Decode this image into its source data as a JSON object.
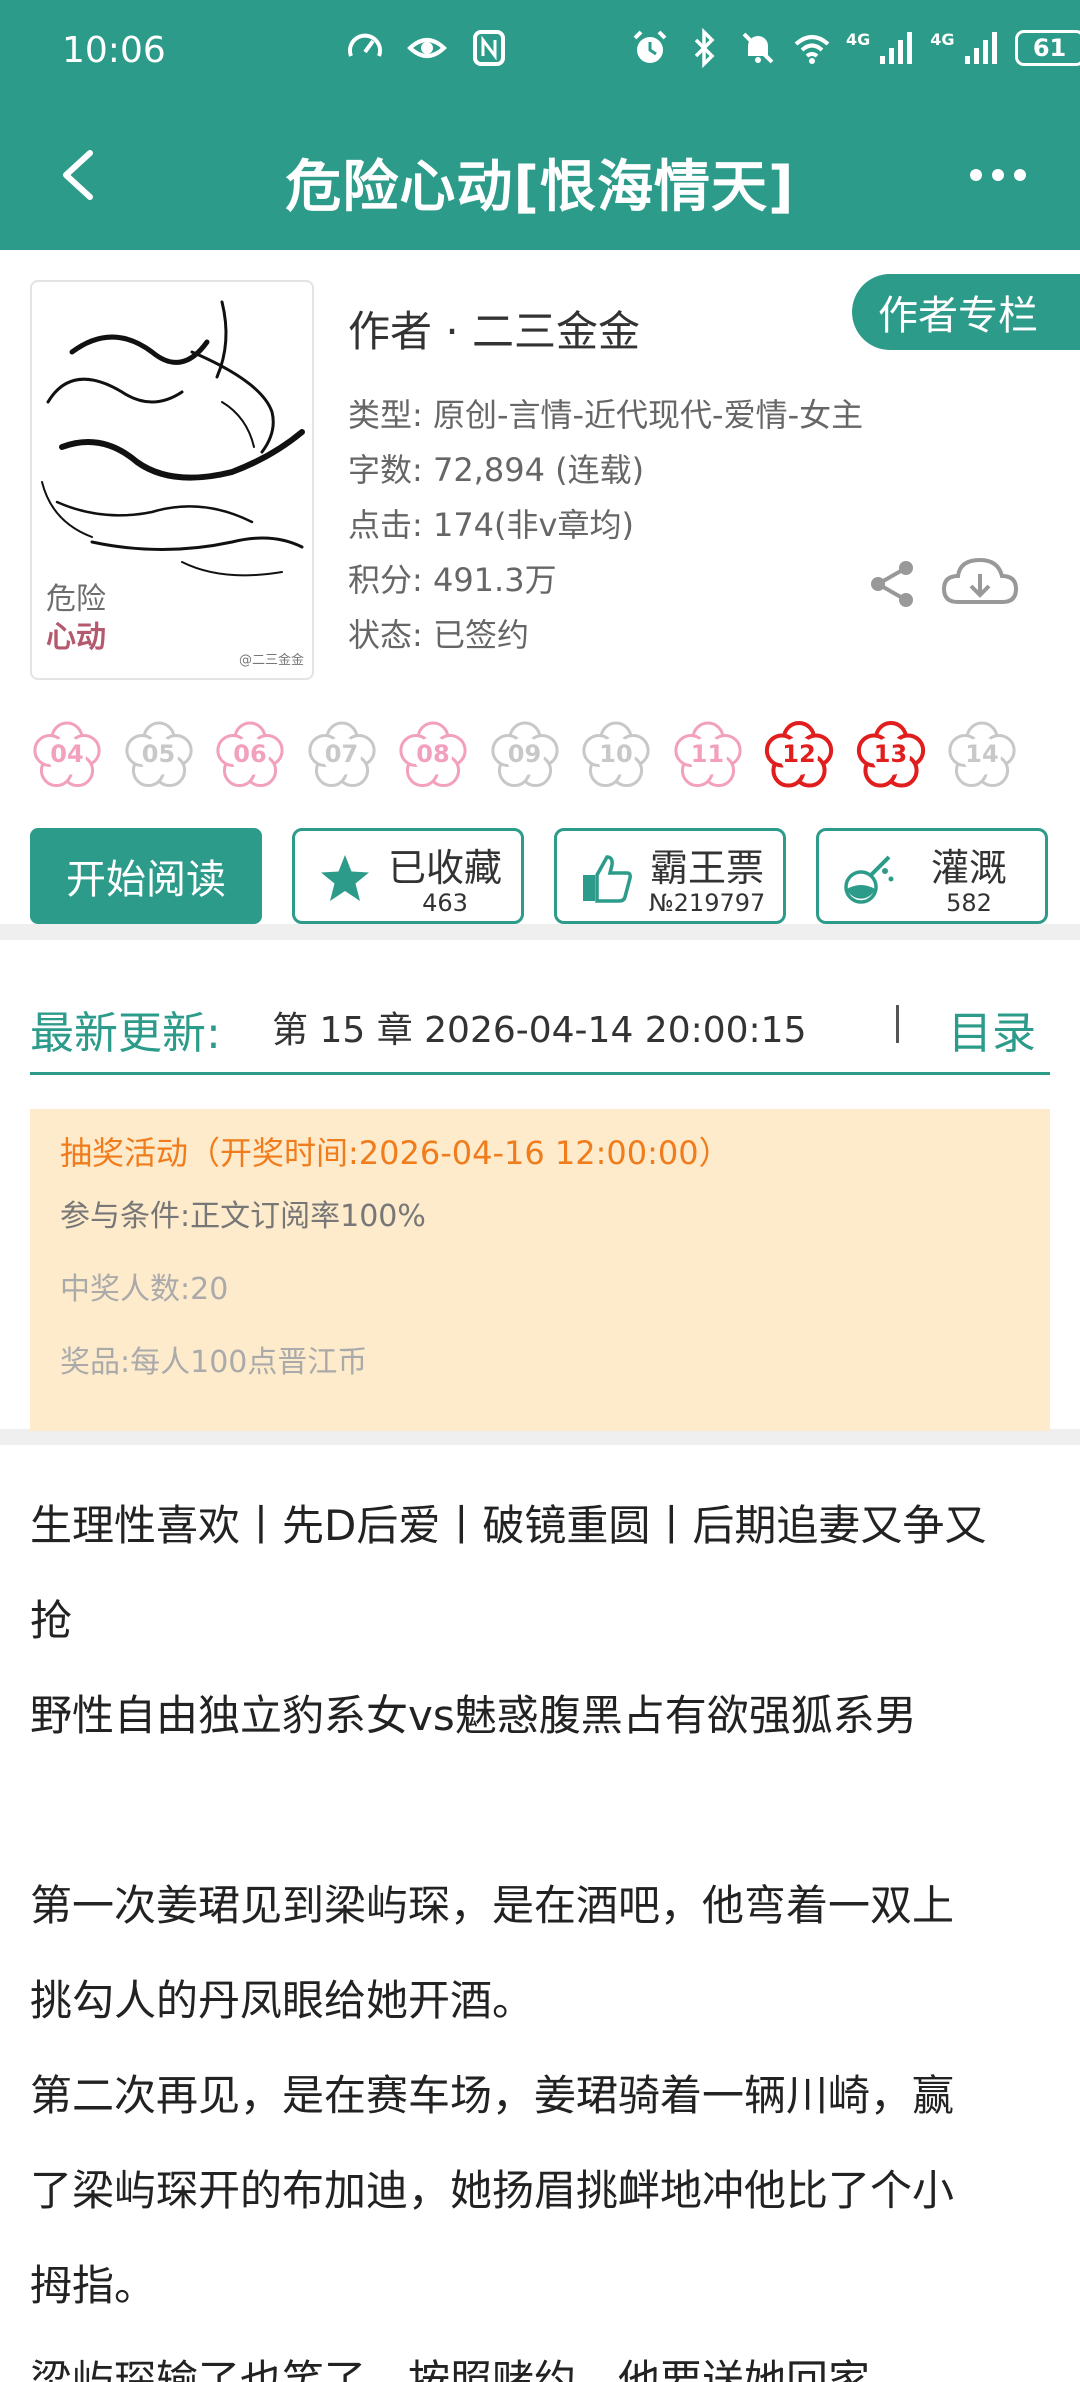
{
  "status": {
    "time": "10:06",
    "network_1": "4G",
    "network_2": "4G",
    "battery": "61"
  },
  "appbar": {
    "title": "危险心动[恨海情天]"
  },
  "book": {
    "cover_title_1": "危险",
    "cover_title_2": "心动",
    "cover_credit": "@二三金金",
    "author_line": "作者 · 二三金金",
    "author_column_label": "作者专栏",
    "meta": [
      "类型: 原创-言情-近代现代-爱情-女主",
      "字数: 72,894 (连载)",
      "点击: 174(非v章均)",
      "积分: 491.3万",
      "状态: 已签约"
    ]
  },
  "flowers": [
    {
      "num": "04",
      "style": "pink"
    },
    {
      "num": "05",
      "style": "grey"
    },
    {
      "num": "06",
      "style": "pink"
    },
    {
      "num": "07",
      "style": "grey"
    },
    {
      "num": "08",
      "style": "pink"
    },
    {
      "num": "09",
      "style": "grey"
    },
    {
      "num": "10",
      "style": "grey"
    },
    {
      "num": "11",
      "style": "pink"
    },
    {
      "num": "12",
      "style": "red"
    },
    {
      "num": "13",
      "style": "red"
    },
    {
      "num": "14",
      "style": "grey"
    }
  ],
  "actions": {
    "read_label": "开始阅读",
    "favorite_label": "已收藏",
    "favorite_count": "463",
    "vote_label": "霸王票",
    "vote_count": "№219797",
    "nutrient_label": "灌溉",
    "nutrient_count": "582"
  },
  "update": {
    "label": "最新更新:",
    "chapter": "第 15 章  2026-04-14 20:00:15",
    "toc_label": "目录"
  },
  "lottery": {
    "title": "抽奖活动（开奖时间:2026-04-16 12:00:00）",
    "condition": "参与条件:正文订阅率100%",
    "winners": "中奖人数:20",
    "prize": "奖品:每人100点晋江币"
  },
  "synopsis": {
    "lines": [
      "生理性喜欢丨先D后爱丨破镜重圆丨后期追妻又争又",
      "抢",
      "野性自由独立豹系女vs魅惑腹黑占有欲强狐系男",
      "",
      "第一次姜珺见到梁屿琛，是在酒吧，他弯着一双上",
      "挑勾人的丹凤眼给她开酒。",
      "第二次再见，是在赛车场，姜珺骑着一辆川崎，赢",
      "了梁屿琛开的布加迪，她扬眉挑衅地冲他比了个小",
      "拇指。",
      "梁屿琛输了也笑了，按照赌约，他要送她回家。"
    ]
  },
  "colors": {
    "accent": "#2c9b8a",
    "lottery_bg": "#fdebcc",
    "lottery_title": "#f07c1c",
    "flower_pink": "#f2a0bd",
    "flower_red": "#e01e1e",
    "flower_grey": "#c8c8c8"
  }
}
